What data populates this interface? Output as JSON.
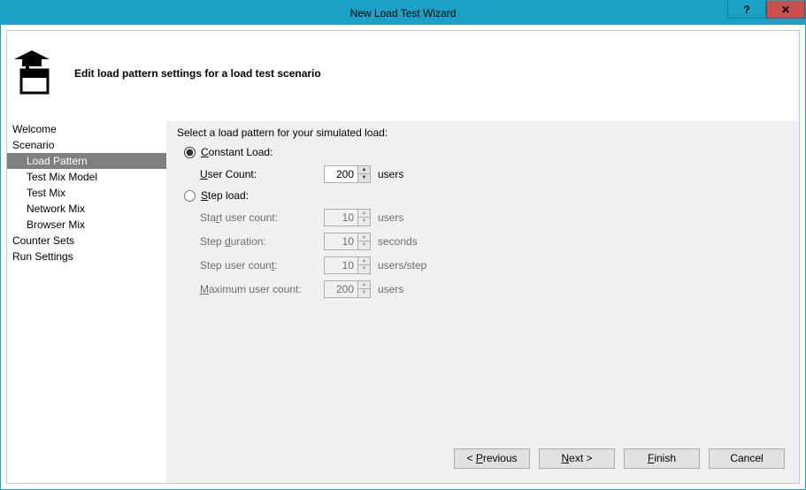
{
  "window": {
    "title": "New Load Test Wizard"
  },
  "header": {
    "title": "Edit load pattern settings for a load test scenario"
  },
  "nav": {
    "items": [
      {
        "label": "Welcome",
        "indent": 0,
        "selected": false
      },
      {
        "label": "Scenario",
        "indent": 0,
        "selected": false
      },
      {
        "label": "Load Pattern",
        "indent": 1,
        "selected": true
      },
      {
        "label": "Test Mix Model",
        "indent": 1,
        "selected": false
      },
      {
        "label": "Test Mix",
        "indent": 1,
        "selected": false
      },
      {
        "label": "Network Mix",
        "indent": 1,
        "selected": false
      },
      {
        "label": "Browser Mix",
        "indent": 1,
        "selected": false
      },
      {
        "label": "Counter Sets",
        "indent": 0,
        "selected": false
      },
      {
        "label": "Run Settings",
        "indent": 0,
        "selected": false
      }
    ]
  },
  "main": {
    "heading": "Select a load pattern for your simulated load:",
    "options": {
      "constant": {
        "label": "Constant Load:",
        "checked": true
      },
      "step": {
        "label": "Step load:",
        "checked": false
      }
    },
    "fields": {
      "user_count": {
        "label": "User Count:",
        "value": "200",
        "unit": "users",
        "enabled": true
      },
      "start_user": {
        "label": "Start user count:",
        "value": "10",
        "unit": "users",
        "enabled": false
      },
      "step_duration": {
        "label": "Step duration:",
        "value": "10",
        "unit": "seconds",
        "enabled": false
      },
      "step_user": {
        "label": "Step user count:",
        "value": "10",
        "unit": "users/step",
        "enabled": false
      },
      "max_user": {
        "label": "Maximum user count:",
        "value": "200",
        "unit": "users",
        "enabled": false
      }
    }
  },
  "footer": {
    "previous": "< Previous",
    "next": "Next >",
    "finish": "Finish",
    "cancel": "Cancel"
  }
}
